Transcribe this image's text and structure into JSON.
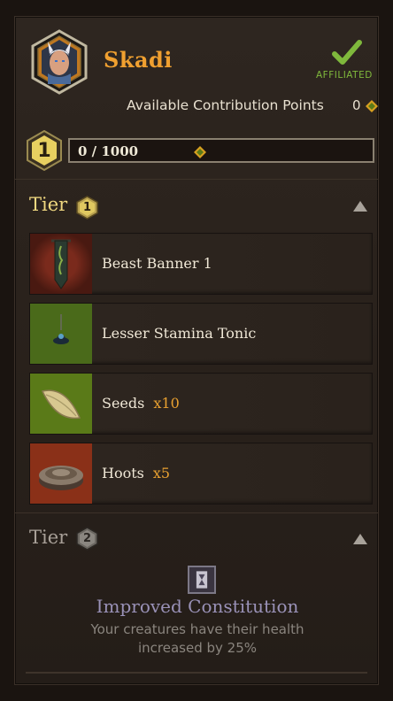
{
  "hero": {
    "name": "Skadi",
    "status": "AFFILIATED"
  },
  "contribution": {
    "label": "Available Contribution Points",
    "value": "0"
  },
  "progress": {
    "level": "1",
    "text": "0 / 1000",
    "fraction": 0.0
  },
  "tiers": [
    {
      "label": "Tier",
      "number": "1",
      "expanded": true
    },
    {
      "label": "Tier",
      "number": "2",
      "expanded": false
    }
  ],
  "rewards": [
    {
      "label": "Beast Banner 1",
      "qty": "",
      "icon": "banner-icon",
      "bg": "#7a2a1c"
    },
    {
      "label": "Lesser Stamina Tonic",
      "qty": "",
      "icon": "tonic-icon",
      "bg": "#4a6a1a"
    },
    {
      "label": "Seeds",
      "qty": "x10",
      "icon": "seeds-icon",
      "bg": "#5a7a18"
    },
    {
      "label": "Hoots",
      "qty": "x5",
      "icon": "hoots-icon",
      "bg": "#8a3018"
    }
  ],
  "perk": {
    "title": "Improved Constitution",
    "description": "Your creatures have their health increased by 25%",
    "icon": "hourglass-scroll-icon"
  },
  "colors": {
    "accent": "#f0a030",
    "affiliated": "#7fb83c",
    "qty": "#e8a030"
  }
}
